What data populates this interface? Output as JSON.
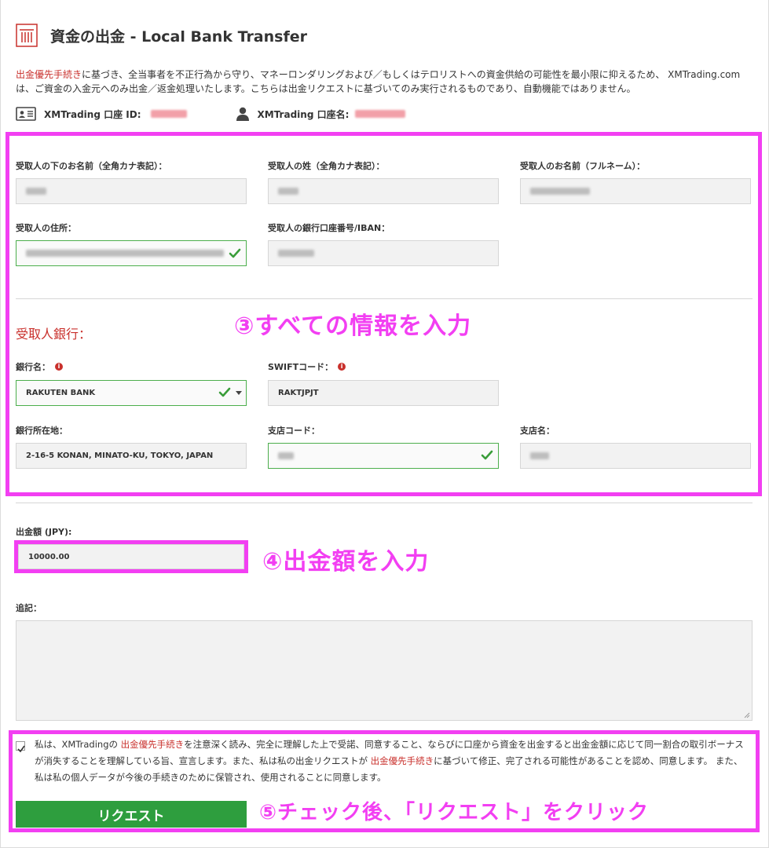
{
  "header": {
    "title": "資金の出金 - Local Bank Transfer"
  },
  "notice": {
    "link": "出金優先手続き",
    "text": "に基づき、全当事者を不正行為から守り、マネーロンダリングおよび／もしくはテロリストへの資金供給の可能性を最小限に抑えるため、 XMTrading.com は、ご資金の入金元へのみ出金／返金処理いたします。こちらは出金リクエストに基づいてのみ実行されるものであり、自動機能ではありません。"
  },
  "account": {
    "id_label": "XMTrading 口座 ID:",
    "name_label": "XMTrading 口座名:"
  },
  "beneficiary": {
    "first_name_label": "受取人の下のお名前（全角カナ表記）：",
    "last_name_label": "受取人の姓（全角カナ表記）：",
    "full_name_label": "受取人のお名前（フルネーム）：",
    "address_label": "受取人の住所：",
    "account_number_label": "受取人の銀行口座番号/IBAN："
  },
  "bank": {
    "section_title": "受取人銀行：",
    "bank_name_label": "銀行名：",
    "bank_name_value": "RAKUTEN BANK",
    "swift_label": "SWIFTコード：",
    "swift_value": "RAKTJPJT",
    "bank_address_label": "銀行所在地：",
    "bank_address_value": "2-16-5 KONAN, MINATO-KU, TOKYO, JAPAN",
    "branch_code_label": "支店コード：",
    "branch_name_label": "支店名："
  },
  "amount": {
    "label": "出金額 (JPY):",
    "value": "10000.00"
  },
  "notes": {
    "label": "追記："
  },
  "agreement": {
    "text1": "私は、XMTradingの ",
    "link1": "出金優先手続き",
    "text2": "を注意深く読み、完全に理解した上で受諾、同意すること、ならびに口座から資金を出金すると出金金額に応じて同一割合の取引ボーナスが消失することを理解している旨、宣言します。また、私は私の出金リクエストが ",
    "link2": "出金優先手続き",
    "text3": "に基づいて修正、完了される可能性があることを認め、同意します。 また、私は私の個人データが今後の手続きのために保管され、使用されることに同意します。",
    "checked": true
  },
  "request_button": {
    "label": "リクエスト"
  },
  "annotations": {
    "step3": "③すべての情報を入力",
    "step4": "④出金額を入力",
    "step5": "⑤チェック後、「リクエスト」をクリック"
  },
  "colors": {
    "accent_red": "#c9302c",
    "success_green": "#2e9e3e",
    "annotation_magenta": "#f23ff2"
  }
}
